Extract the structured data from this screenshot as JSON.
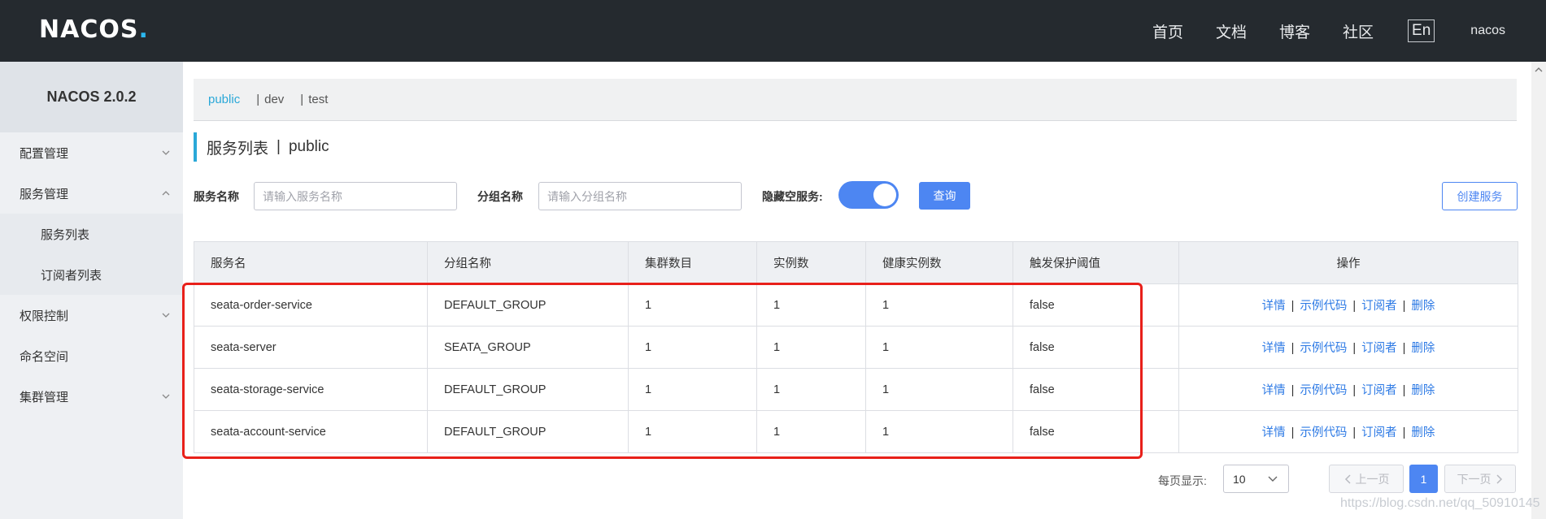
{
  "brand": {
    "logo_text": "NACOS",
    "logo_dot": "."
  },
  "topnav": {
    "items": [
      "首页",
      "文档",
      "博客",
      "社区"
    ],
    "lang": "En",
    "user": "nacos"
  },
  "sidebar": {
    "title": "NACOS 2.0.2",
    "items": [
      {
        "label": "配置管理"
      },
      {
        "label": "服务管理"
      },
      {
        "label": "服务列表"
      },
      {
        "label": "订阅者列表"
      },
      {
        "label": "权限控制"
      },
      {
        "label": "命名空间"
      },
      {
        "label": "集群管理"
      }
    ]
  },
  "namespaces": {
    "items": [
      "public",
      "dev",
      "test"
    ],
    "sep": "|",
    "active": "public"
  },
  "heading": {
    "title": "服务列表",
    "sep": "|",
    "namespace": "public"
  },
  "filters": {
    "service_label": "服务名称",
    "service_placeholder": "请输入服务名称",
    "group_label": "分组名称",
    "group_placeholder": "请输入分组名称",
    "hide_empty_label": "隐藏空服务:",
    "hide_empty_on": true,
    "query_button": "查询",
    "create_button": "创建服务"
  },
  "table": {
    "columns": [
      "服务名",
      "分组名称",
      "集群数目",
      "实例数",
      "健康实例数",
      "触发保护阈值",
      "操作"
    ],
    "rows": [
      [
        "seata-order-service",
        "DEFAULT_GROUP",
        "1",
        "1",
        "1",
        "false"
      ],
      [
        "seata-server",
        "SEATA_GROUP",
        "1",
        "1",
        "1",
        "false"
      ],
      [
        "seata-storage-service",
        "DEFAULT_GROUP",
        "1",
        "1",
        "1",
        "false"
      ],
      [
        "seata-account-service",
        "DEFAULT_GROUP",
        "1",
        "1",
        "1",
        "false"
      ]
    ],
    "actions": [
      "详情",
      "示例代码",
      "订阅者",
      "删除"
    ],
    "action_sep": "|"
  },
  "pagination": {
    "page_size_label": "每页显示:",
    "page_size": "10",
    "prev": "上一页",
    "next": "下一页",
    "current": "1"
  },
  "watermark": "https://blog.csdn.net/qq_50910145",
  "colors": {
    "topbar": "#252a2f",
    "accent": "#2aa8d8",
    "primary": "#4d86f2",
    "highlight": "#e8201a",
    "link": "#2f7be5"
  }
}
